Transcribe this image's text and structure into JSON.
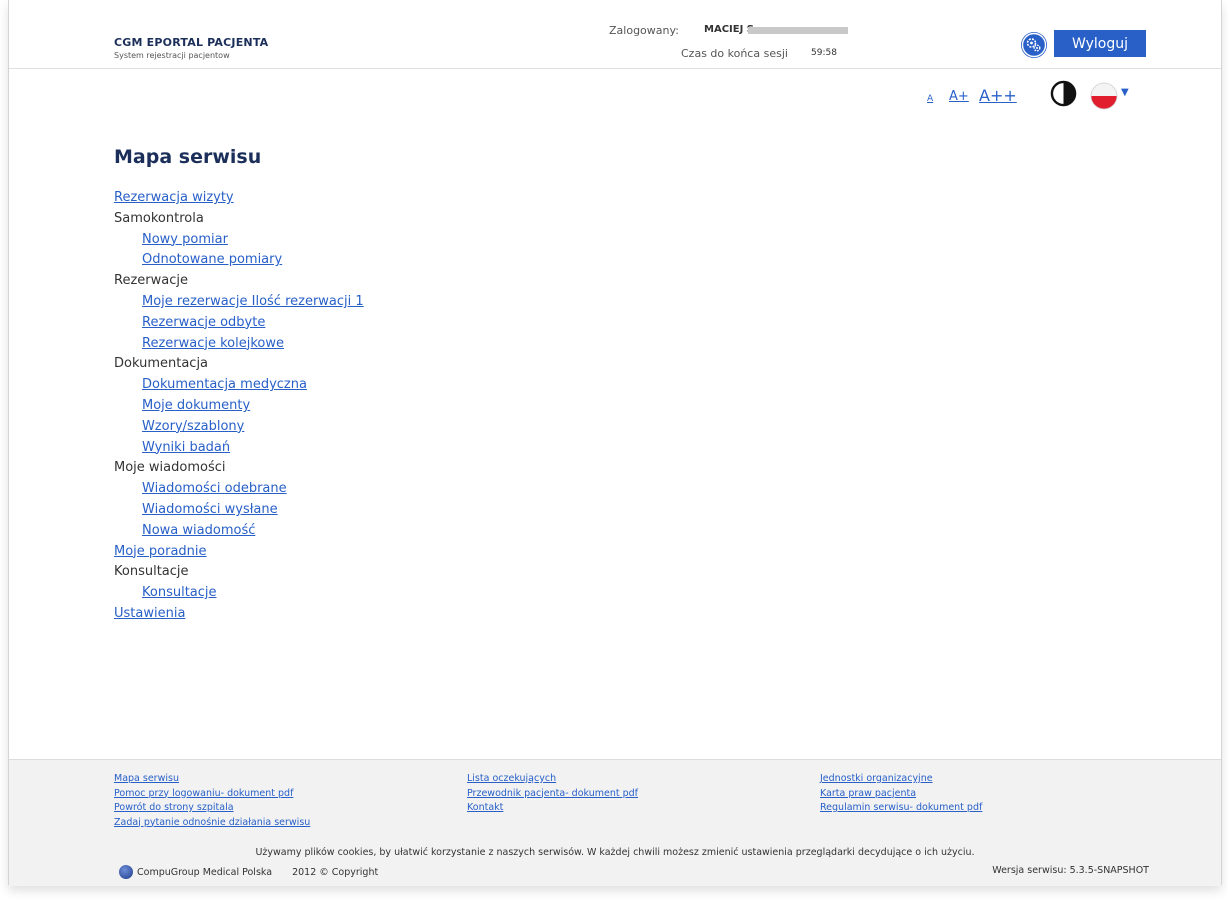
{
  "header": {
    "brand_title": "CGM EPORTAL PACJENTA",
    "brand_subtitle": "System rejestracji pacjentow",
    "logged_label": "Zalogowany:",
    "user_name": "MACIEJ S",
    "session_label": "Czas do końca sesji",
    "session_time": "59:58",
    "logout_label": "Wyloguj",
    "accent_color": "#2860c8",
    "settings_icon": "gears-icon"
  },
  "accessibility": {
    "font_small": "A",
    "font_medium": "A+",
    "font_large": "A++",
    "contrast_icon": "contrast-icon",
    "language_icon": "poland-flag-icon"
  },
  "main": {
    "title": "Mapa serwisu",
    "items": [
      {
        "label": "Rezerwacja wizyty",
        "link": true,
        "level": 0
      },
      {
        "label": "Samokontrola",
        "link": false,
        "level": 0
      },
      {
        "label": "Nowy pomiar",
        "link": true,
        "level": 1
      },
      {
        "label": "Odnotowane pomiary",
        "link": true,
        "level": 1
      },
      {
        "label": "Rezerwacje",
        "link": false,
        "level": 0
      },
      {
        "label": "Moje rezerwacje Ilość rezerwacji 1",
        "link": true,
        "level": 1
      },
      {
        "label": "Rezerwacje odbyte",
        "link": true,
        "level": 1
      },
      {
        "label": "Rezerwacje kolejkowe",
        "link": true,
        "level": 1
      },
      {
        "label": "Dokumentacja",
        "link": false,
        "level": 0
      },
      {
        "label": "Dokumentacja medyczna",
        "link": true,
        "level": 1
      },
      {
        "label": "Moje dokumenty",
        "link": true,
        "level": 1
      },
      {
        "label": "Wzory/szablony",
        "link": true,
        "level": 1
      },
      {
        "label": "Wyniki badań",
        "link": true,
        "level": 1
      },
      {
        "label": "Moje wiadomości",
        "link": false,
        "level": 0
      },
      {
        "label": "Wiadomości odebrane",
        "link": true,
        "level": 1
      },
      {
        "label": "Wiadomości wysłane",
        "link": true,
        "level": 1
      },
      {
        "label": "Nowa wiadomość",
        "link": true,
        "level": 1
      },
      {
        "label": "Moje poradnie",
        "link": true,
        "level": 0
      },
      {
        "label": "Konsultacje",
        "link": false,
        "level": 0
      },
      {
        "label": "Konsultacje",
        "link": true,
        "level": 1
      },
      {
        "label": "Ustawienia",
        "link": true,
        "level": 0
      }
    ]
  },
  "footer": {
    "col1": [
      "Mapa serwisu",
      "Pomoc przy logowaniu- dokument pdf",
      "Powrót do strony szpitala",
      "Zadaj pytanie odnośnie działania serwisu"
    ],
    "col2": [
      "Lista oczekujących",
      "Przewodnik pacjenta- dokument pdf",
      "Kontakt"
    ],
    "col3": [
      "Jednostki organizacyjne",
      "Karta praw pacjenta",
      "Regulamin serwisu- dokument pdf"
    ],
    "cookie_text": "Używamy plików cookies, by ułatwić korzystanie z naszych serwisów. W każdej chwili możesz zmienić ustawienia przeglądarki decydujące o ich użyciu.",
    "company": "CompuGroup Medical Polska",
    "copyright": "2012 © Copyright",
    "version": "Wersja serwisu: 5.3.5-SNAPSHOT"
  }
}
